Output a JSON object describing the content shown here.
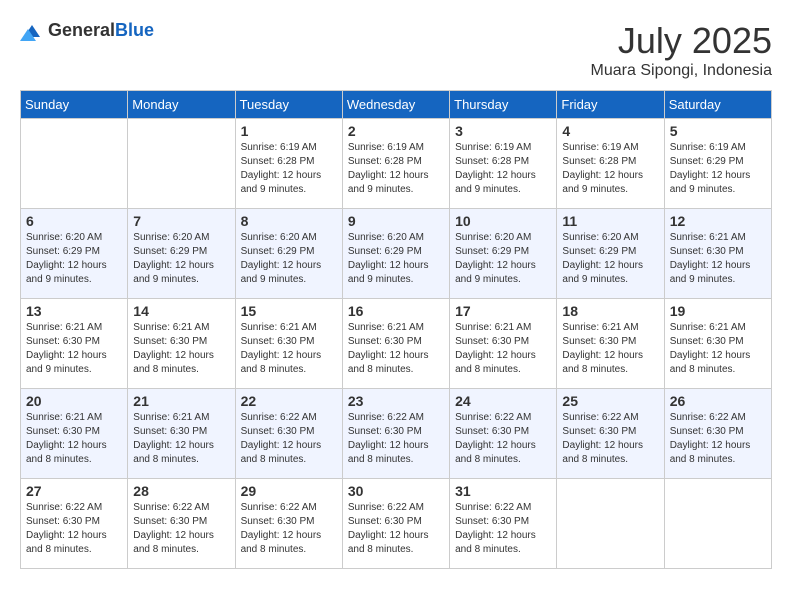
{
  "header": {
    "logo_general": "General",
    "logo_blue": "Blue",
    "month_year": "July 2025",
    "location": "Muara Sipongi, Indonesia"
  },
  "days_of_week": [
    "Sunday",
    "Monday",
    "Tuesday",
    "Wednesday",
    "Thursday",
    "Friday",
    "Saturday"
  ],
  "weeks": [
    [
      {
        "day": "",
        "info": ""
      },
      {
        "day": "",
        "info": ""
      },
      {
        "day": "1",
        "info": "Sunrise: 6:19 AM\nSunset: 6:28 PM\nDaylight: 12 hours and 9 minutes."
      },
      {
        "day": "2",
        "info": "Sunrise: 6:19 AM\nSunset: 6:28 PM\nDaylight: 12 hours and 9 minutes."
      },
      {
        "day": "3",
        "info": "Sunrise: 6:19 AM\nSunset: 6:28 PM\nDaylight: 12 hours and 9 minutes."
      },
      {
        "day": "4",
        "info": "Sunrise: 6:19 AM\nSunset: 6:28 PM\nDaylight: 12 hours and 9 minutes."
      },
      {
        "day": "5",
        "info": "Sunrise: 6:19 AM\nSunset: 6:29 PM\nDaylight: 12 hours and 9 minutes."
      }
    ],
    [
      {
        "day": "6",
        "info": "Sunrise: 6:20 AM\nSunset: 6:29 PM\nDaylight: 12 hours and 9 minutes."
      },
      {
        "day": "7",
        "info": "Sunrise: 6:20 AM\nSunset: 6:29 PM\nDaylight: 12 hours and 9 minutes."
      },
      {
        "day": "8",
        "info": "Sunrise: 6:20 AM\nSunset: 6:29 PM\nDaylight: 12 hours and 9 minutes."
      },
      {
        "day": "9",
        "info": "Sunrise: 6:20 AM\nSunset: 6:29 PM\nDaylight: 12 hours and 9 minutes."
      },
      {
        "day": "10",
        "info": "Sunrise: 6:20 AM\nSunset: 6:29 PM\nDaylight: 12 hours and 9 minutes."
      },
      {
        "day": "11",
        "info": "Sunrise: 6:20 AM\nSunset: 6:29 PM\nDaylight: 12 hours and 9 minutes."
      },
      {
        "day": "12",
        "info": "Sunrise: 6:21 AM\nSunset: 6:30 PM\nDaylight: 12 hours and 9 minutes."
      }
    ],
    [
      {
        "day": "13",
        "info": "Sunrise: 6:21 AM\nSunset: 6:30 PM\nDaylight: 12 hours and 9 minutes."
      },
      {
        "day": "14",
        "info": "Sunrise: 6:21 AM\nSunset: 6:30 PM\nDaylight: 12 hours and 8 minutes."
      },
      {
        "day": "15",
        "info": "Sunrise: 6:21 AM\nSunset: 6:30 PM\nDaylight: 12 hours and 8 minutes."
      },
      {
        "day": "16",
        "info": "Sunrise: 6:21 AM\nSunset: 6:30 PM\nDaylight: 12 hours and 8 minutes."
      },
      {
        "day": "17",
        "info": "Sunrise: 6:21 AM\nSunset: 6:30 PM\nDaylight: 12 hours and 8 minutes."
      },
      {
        "day": "18",
        "info": "Sunrise: 6:21 AM\nSunset: 6:30 PM\nDaylight: 12 hours and 8 minutes."
      },
      {
        "day": "19",
        "info": "Sunrise: 6:21 AM\nSunset: 6:30 PM\nDaylight: 12 hours and 8 minutes."
      }
    ],
    [
      {
        "day": "20",
        "info": "Sunrise: 6:21 AM\nSunset: 6:30 PM\nDaylight: 12 hours and 8 minutes."
      },
      {
        "day": "21",
        "info": "Sunrise: 6:21 AM\nSunset: 6:30 PM\nDaylight: 12 hours and 8 minutes."
      },
      {
        "day": "22",
        "info": "Sunrise: 6:22 AM\nSunset: 6:30 PM\nDaylight: 12 hours and 8 minutes."
      },
      {
        "day": "23",
        "info": "Sunrise: 6:22 AM\nSunset: 6:30 PM\nDaylight: 12 hours and 8 minutes."
      },
      {
        "day": "24",
        "info": "Sunrise: 6:22 AM\nSunset: 6:30 PM\nDaylight: 12 hours and 8 minutes."
      },
      {
        "day": "25",
        "info": "Sunrise: 6:22 AM\nSunset: 6:30 PM\nDaylight: 12 hours and 8 minutes."
      },
      {
        "day": "26",
        "info": "Sunrise: 6:22 AM\nSunset: 6:30 PM\nDaylight: 12 hours and 8 minutes."
      }
    ],
    [
      {
        "day": "27",
        "info": "Sunrise: 6:22 AM\nSunset: 6:30 PM\nDaylight: 12 hours and 8 minutes."
      },
      {
        "day": "28",
        "info": "Sunrise: 6:22 AM\nSunset: 6:30 PM\nDaylight: 12 hours and 8 minutes."
      },
      {
        "day": "29",
        "info": "Sunrise: 6:22 AM\nSunset: 6:30 PM\nDaylight: 12 hours and 8 minutes."
      },
      {
        "day": "30",
        "info": "Sunrise: 6:22 AM\nSunset: 6:30 PM\nDaylight: 12 hours and 8 minutes."
      },
      {
        "day": "31",
        "info": "Sunrise: 6:22 AM\nSunset: 6:30 PM\nDaylight: 12 hours and 8 minutes."
      },
      {
        "day": "",
        "info": ""
      },
      {
        "day": "",
        "info": ""
      }
    ]
  ]
}
